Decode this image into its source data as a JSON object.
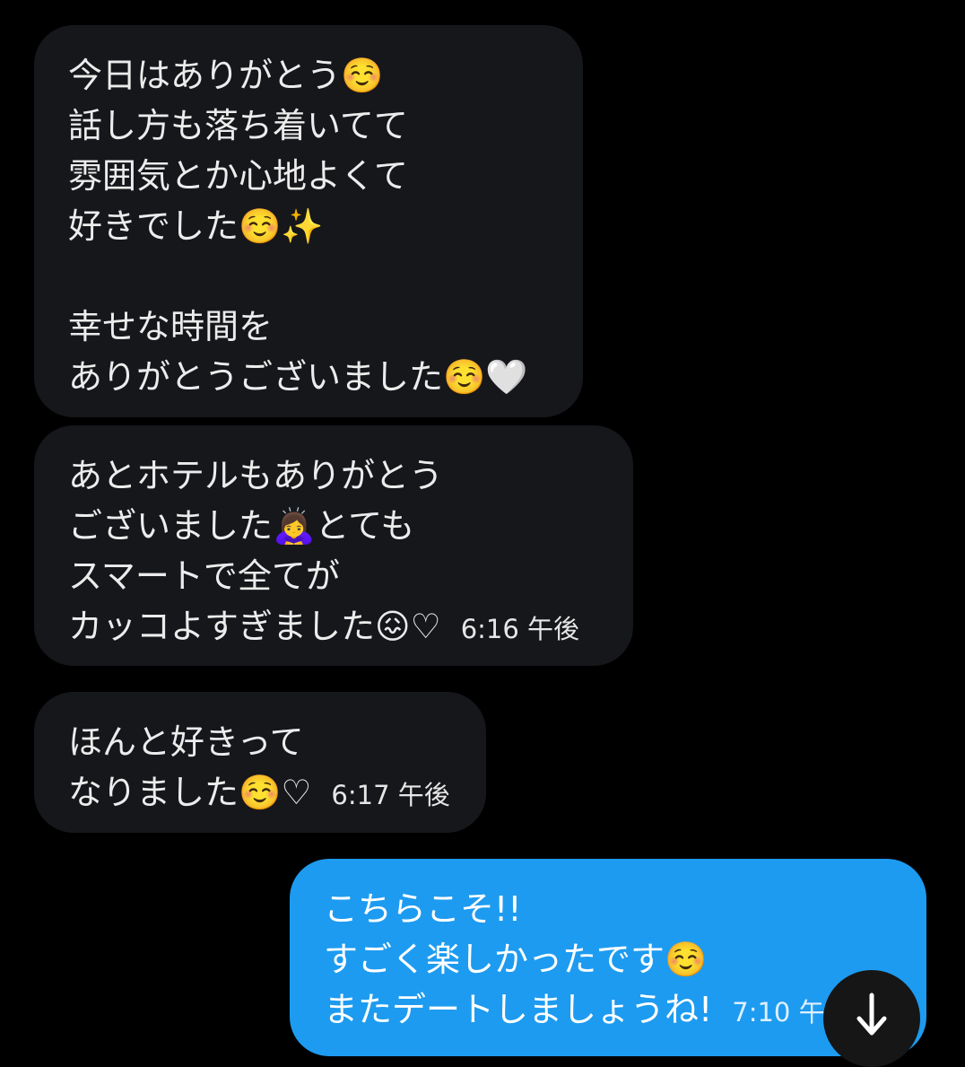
{
  "messages": [
    {
      "direction": "incoming",
      "lines": [
        "今日はありがとう☺️",
        "話し方も落ち着いてて",
        "雰囲気とか心地よくて",
        "好きでした☺️✨",
        "",
        "幸せな時間を",
        "ありがとうございました☺️🤍"
      ],
      "time": ""
    },
    {
      "direction": "incoming",
      "lines": [
        "あとホテルもありがとう",
        "ございました🙇‍♀️とても",
        "スマートで全てが",
        "カッコよすぎました😖♡"
      ],
      "time": "6:16 午後"
    },
    {
      "direction": "incoming",
      "lines": [
        "ほんと好きって",
        "なりました☺️♡"
      ],
      "time": "6:17 午後"
    },
    {
      "direction": "outgoing",
      "lines": [
        "こちらこそ!!",
        "すごく楽しかったです☺️",
        "またデートしましょうね!"
      ],
      "time": "7:10 午"
    }
  ],
  "scroll_button": {
    "icon": "arrow-down-icon"
  },
  "colors": {
    "background": "#000000",
    "incoming_bubble": "#16171b",
    "outgoing_bubble": "#1d9bf0"
  }
}
